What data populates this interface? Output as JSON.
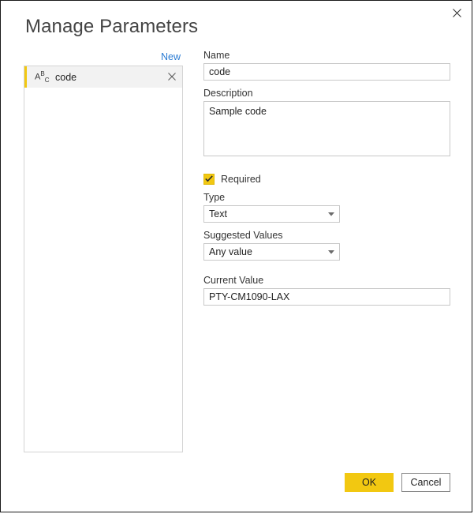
{
  "window": {
    "title": "Manage Parameters",
    "close_icon": "close-icon"
  },
  "left_panel": {
    "new_label": "New",
    "parameters": [
      {
        "name": "code",
        "type_icon": "text-type-icon",
        "icon_glyph_main": "A",
        "icon_glyph_sup": "B",
        "icon_glyph_sub": "C",
        "remove_icon": "close-icon",
        "selected": true,
        "accent_color": "#f2c811"
      }
    ]
  },
  "form": {
    "name_label": "Name",
    "name_value": "code",
    "name_placeholder": "",
    "description_label": "Description",
    "description_value": "Sample code",
    "description_placeholder": "",
    "required_label": "Required",
    "required_checked": true,
    "required_checkbox_color": "#f2c811",
    "type_label": "Type",
    "type_value": "Text",
    "suggested_values_label": "Suggested Values",
    "suggested_values_value": "Any value",
    "current_value_label": "Current Value",
    "current_value": "PTY-CM1090-LAX",
    "current_value_placeholder": "",
    "dropdown_icon": "chevron-down-icon"
  },
  "footer": {
    "ok_label": "OK",
    "cancel_label": "Cancel",
    "ok_color": "#f2c811"
  }
}
